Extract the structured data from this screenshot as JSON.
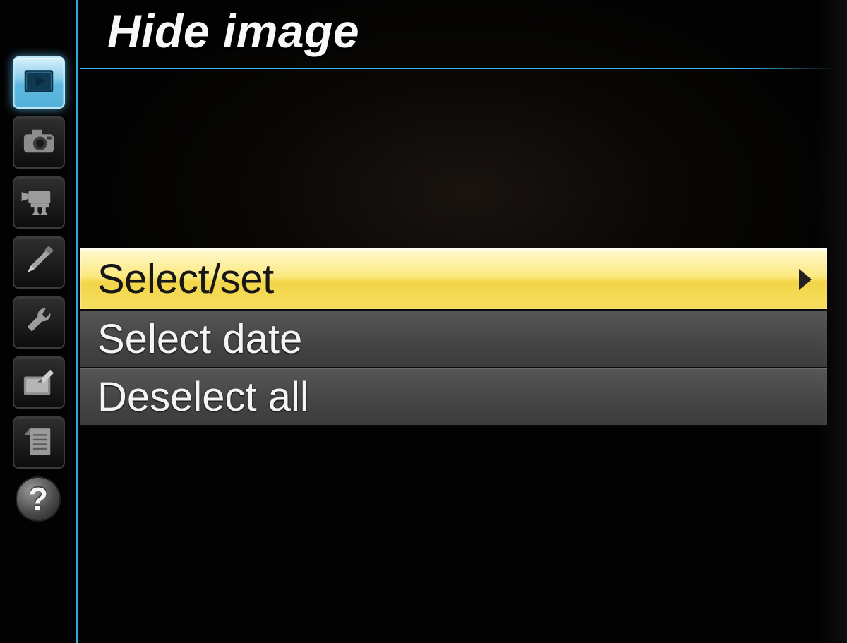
{
  "title": "Hide image",
  "sidebar": {
    "activeIndex": 0,
    "tabs": [
      {
        "name": "playback",
        "icon": "play-rect-icon"
      },
      {
        "name": "shooting",
        "icon": "camera-icon"
      },
      {
        "name": "movie",
        "icon": "movie-camera-icon"
      },
      {
        "name": "custom",
        "icon": "pencil-icon"
      },
      {
        "name": "setup",
        "icon": "wrench-icon"
      },
      {
        "name": "retouch",
        "icon": "retouch-brush-icon"
      },
      {
        "name": "mymenu",
        "icon": "list-page-icon"
      },
      {
        "name": "help",
        "icon": "question-icon",
        "label": "?"
      }
    ]
  },
  "menu": {
    "items": [
      {
        "label": "Select/set",
        "selected": true,
        "hasChevron": true
      },
      {
        "label": "Select date",
        "selected": false,
        "hasChevron": false
      },
      {
        "label": "Deselect all",
        "selected": false,
        "hasChevron": false
      }
    ]
  },
  "colors": {
    "accent": "#3cb4e8",
    "highlight": "#f6de5f"
  }
}
